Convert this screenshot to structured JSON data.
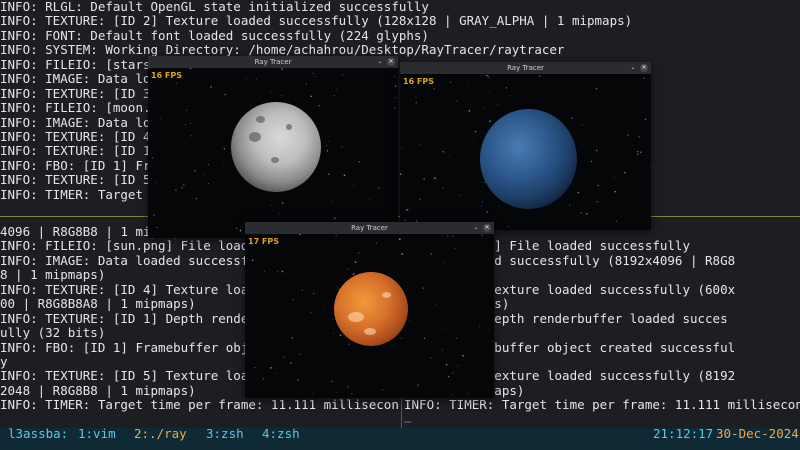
{
  "terminal": {
    "top_lines": [
      "INFO: RLGL: Default OpenGL state initialized successfully",
      "INFO: TEXTURE: [ID 2] Texture loaded successfully (128x128 | GRAY_ALPHA | 1 mipmaps)",
      "INFO: FONT: Default font loaded successfully (224 glyphs)",
      "INFO: SYSTEM: Working Directory: /home/achahrou/Desktop/RayTracer/raytracer",
      "INFO: FILEIO: [stars.",
      "INFO: IMAGE: Data load",
      "INFO: TEXTURE: [ID 3]",
      "INFO: FILEIO: [moon.p",
      "INFO: IMAGE: Data loa",
      "INFO: TEXTURE: [ID 4]",
      "INFO: TEXTURE: [ID 1]",
      "INFO: FBO: [ID 1] Fram",
      "INFO: TEXTURE: [ID 5]",
      "INFO: TIMER: Target t"
    ],
    "bottom_left_lines": [
      "4096 | R8G8B8 | 1 mipmaps)",
      "INFO: FILEIO: [sun.png] File loaded",
      "INFO: IMAGE: Data loaded successfull",
      "8 | 1 mipmaps)",
      "INFO: TEXTURE: [ID 4] Texture loade",
      "00 | R8G8B8A8 | 1 mipmaps)",
      "INFO: TEXTURE: [ID 1] Depth renderb",
      "ully (32 bits)",
      "INFO: FBO: [ID 1] Framebuffer objec",
      "y",
      "INFO: TEXTURE: [ID 5] Texture loade",
      "2048 | R8G8B8 | 1 mipmaps)",
      "INFO: TIMER: Target time per frame: 11.111 milliseconds"
    ],
    "bottom_right_lines": [
      "",
      "  [earth.png] File loaded successfully",
      "  Data loaded successfully (8192x4096 | R8G8",
      "  s)",
      "  : [ID 4] Texture loaded successfully (600x",
      "  | 1 mipmaps)",
      "  : [ID 1] Depth renderbuffer loaded succes",
      "  s)",
      "  D 1] Framebuffer object created successful",
      "",
      "  : [ID 5] Texture loaded successfully (8192",
      "  8 | 1 mipmaps)",
      "INFO: TIMER: Target time per frame: 11.111 milliseconds"
    ]
  },
  "statusbar": {
    "session": "l3assba:",
    "windows": [
      {
        "label": "1:vim",
        "active": false
      },
      {
        "label": "2:./ray",
        "active": true
      },
      {
        "label": "3:zsh",
        "active": false
      },
      {
        "label": "4:zsh",
        "active": false
      }
    ],
    "time": "21:12:17",
    "date": "30-Dec-2024"
  },
  "windows": [
    {
      "title": "Ray Tracer",
      "fps": "16 FPS",
      "planet": "moon"
    },
    {
      "title": "Ray Tracer",
      "fps": "16 FPS",
      "planet": "earth"
    },
    {
      "title": "Ray Tracer",
      "fps": "17 FPS",
      "planet": "mars"
    }
  ],
  "icons": {
    "minimize": "chevron-down-icon",
    "close": "close-icon"
  },
  "colors": {
    "fps_text": "#e0a21d",
    "status_accent": "#5dc6e6",
    "status_active": "#f0a74a",
    "pane_separator": "#7f8b39"
  }
}
